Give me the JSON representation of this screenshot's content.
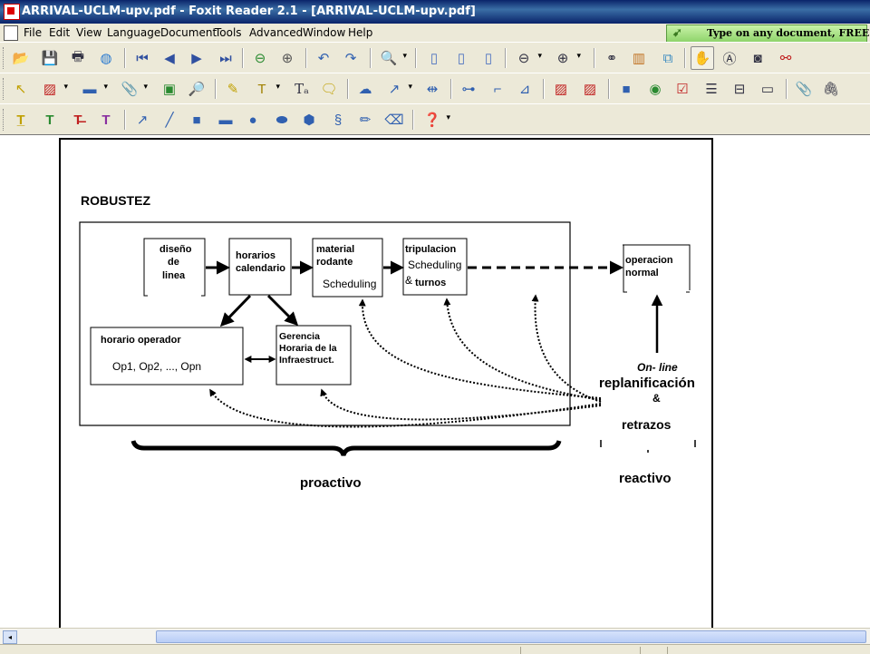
{
  "window": {
    "title": "ARRIVAL-UCLM-upv.pdf - Foxit Reader 2.1 - [ARRIVAL-UCLM-upv.pdf]"
  },
  "menu": [
    "File",
    "Edit",
    "View",
    "Language",
    "Document",
    "Tools",
    "Advanced",
    "Window",
    "Help"
  ],
  "promo": {
    "text": "Type on any document, FREE!"
  },
  "toolbar_icons": {
    "row1": [
      "open-icon",
      "save-icon",
      "print-icon",
      "email-icon",
      "first-page-icon",
      "previous-page-icon",
      "next-page-icon",
      "last-page-icon",
      "go-back-icon",
      "go-forward-icon",
      "rotate-left-icon",
      "rotate-right-icon",
      "zoom-in-icon",
      "single-page-icon",
      "continuous-icon",
      "facing-icon",
      "zoom-out-icon",
      "zoom-in-plus-icon",
      "find-icon",
      "bookmark-icon",
      "fit-icon",
      "hand-tool-icon",
      "text-select-icon",
      "snapshot-icon",
      "eraser-glasses-icon"
    ],
    "row2": [
      "select-arrow-icon",
      "stamp-icon",
      "rectangle-icon",
      "attachment-icon",
      "image-icon",
      "magnifier-icon",
      "highlight-icon",
      "typewriter-icon",
      "text-tool-icon",
      "note-icon",
      "cloud-icon",
      "arrow-tool-icon",
      "dimension-icon",
      "link-icon",
      "connector-icon",
      "polygon-icon",
      "signature-icon",
      "signature2-icon",
      "form-rectangle-icon",
      "radio-icon",
      "checkbox-icon",
      "list-box-icon",
      "combo-box-icon",
      "text-field-icon",
      "clip-icon",
      "clip2-icon"
    ],
    "row3": [
      "underline-text-icon",
      "squiggly-text-icon",
      "strike-text-icon",
      "replace-text-icon",
      "arrow-draw-icon",
      "line-draw-icon",
      "square-draw-icon",
      "rect-draw-icon",
      "circle-draw-icon",
      "ellipse-draw-icon",
      "polygon-draw-icon",
      "cloud-draw-icon",
      "pencil-icon",
      "eraser-icon",
      "help-icon"
    ]
  },
  "diagram": {
    "title": "ROBUSTEZ",
    "boxes": {
      "diseno": [
        "diseño",
        "de",
        "linea"
      ],
      "horarios": [
        "horarios",
        "calendario"
      ],
      "material": [
        "material",
        "rodante"
      ],
      "material_sub": "Scheduling",
      "tripulacion": "tripulacion",
      "tripulacion_sub1": "Scheduling",
      "tripulacion_sub2_amp": "&",
      "tripulacion_sub2": "turnos",
      "operacion": [
        "operacion",
        "normal"
      ],
      "horario_operador": "horario operador",
      "ops": "Op1, Op2, ..., Opn",
      "gerencia": [
        "Gerencia",
        "Horaria de la",
        "Infraestruct."
      ]
    },
    "online": "On- line",
    "replan": "replanificación",
    "amp": "&",
    "retrazos": "retrazos",
    "proactivo": "proactivo",
    "reactivo": "reactivo"
  }
}
